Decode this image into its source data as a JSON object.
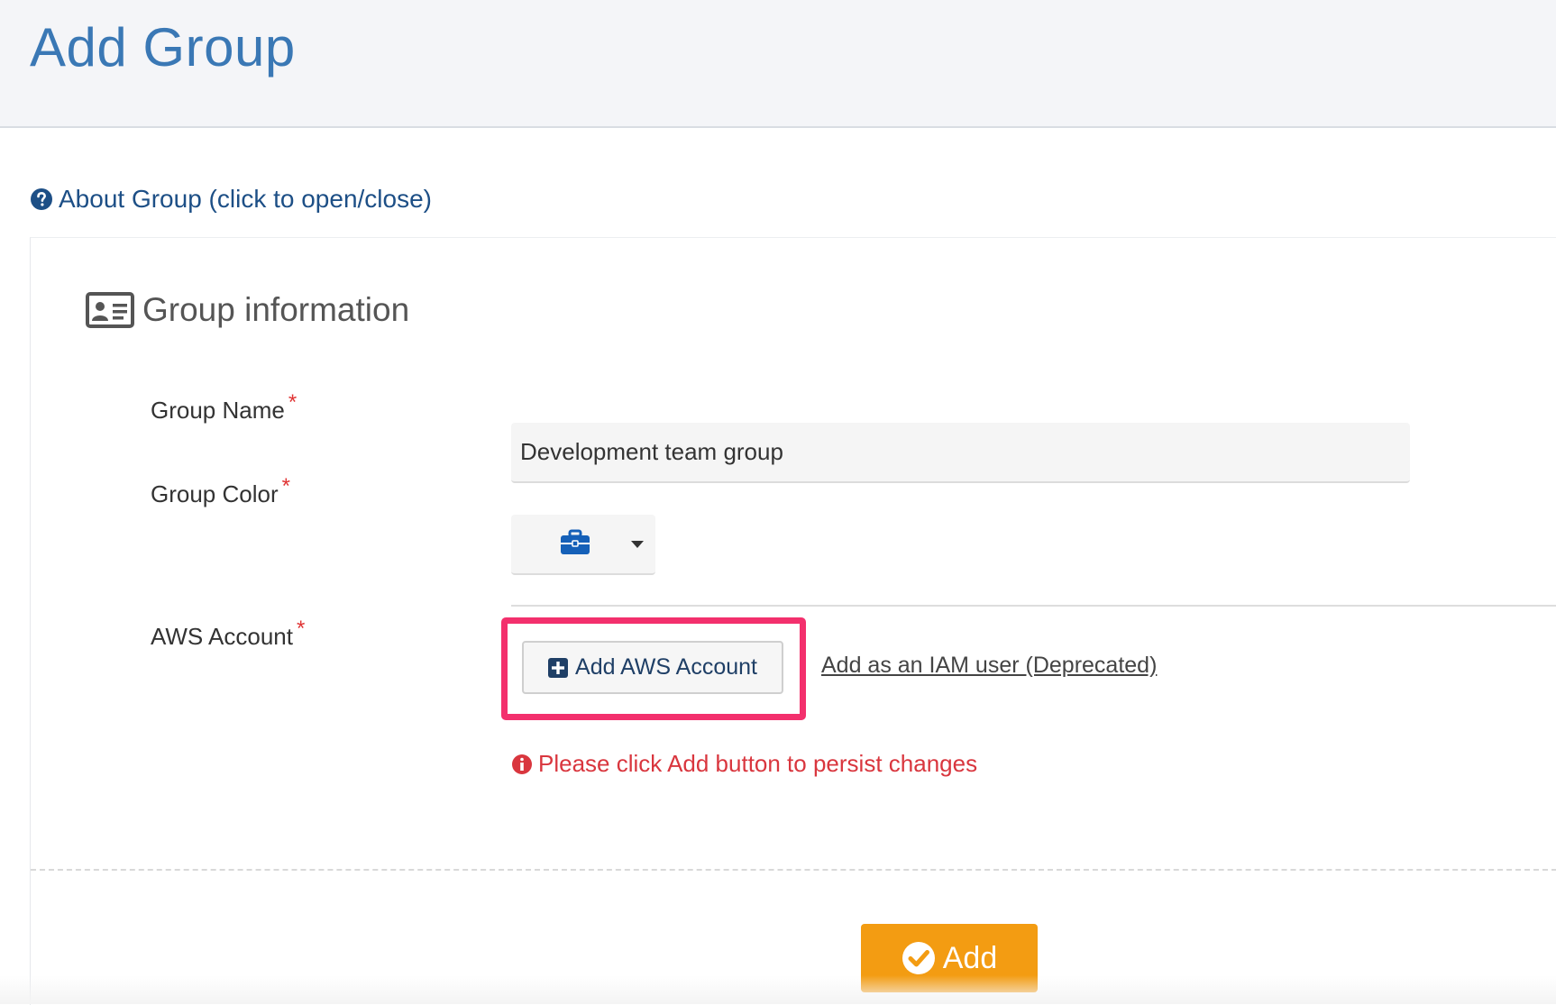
{
  "header": {
    "title": "Add Group"
  },
  "about": {
    "label": "About Group (click to open/close)",
    "icon": "question-circle-icon"
  },
  "section": {
    "title": "Group information",
    "icon": "id-card-icon"
  },
  "fields": {
    "group_name": {
      "label": "Group Name",
      "required_mark": "*",
      "value": "Development team group"
    },
    "group_color": {
      "label": "Group Color",
      "required_mark": "*",
      "selected_icon": "briefcase-icon",
      "icon_color": "#1560b8"
    },
    "aws_account": {
      "label": "AWS Account",
      "required_mark": "*",
      "add_button_label": "Add AWS Account",
      "iam_link_label": "Add as an IAM user (Deprecated)"
    }
  },
  "warning": {
    "text": "Please click Add button to persist changes",
    "icon": "info-circle-icon"
  },
  "submit": {
    "label": "Add",
    "icon": "check-circle-icon"
  },
  "colors": {
    "title_blue": "#3a78b5",
    "link_blue": "#1d4f86",
    "highlight": "#f3306d",
    "error_red": "#d9363e",
    "submit_orange": "#f39c12"
  }
}
